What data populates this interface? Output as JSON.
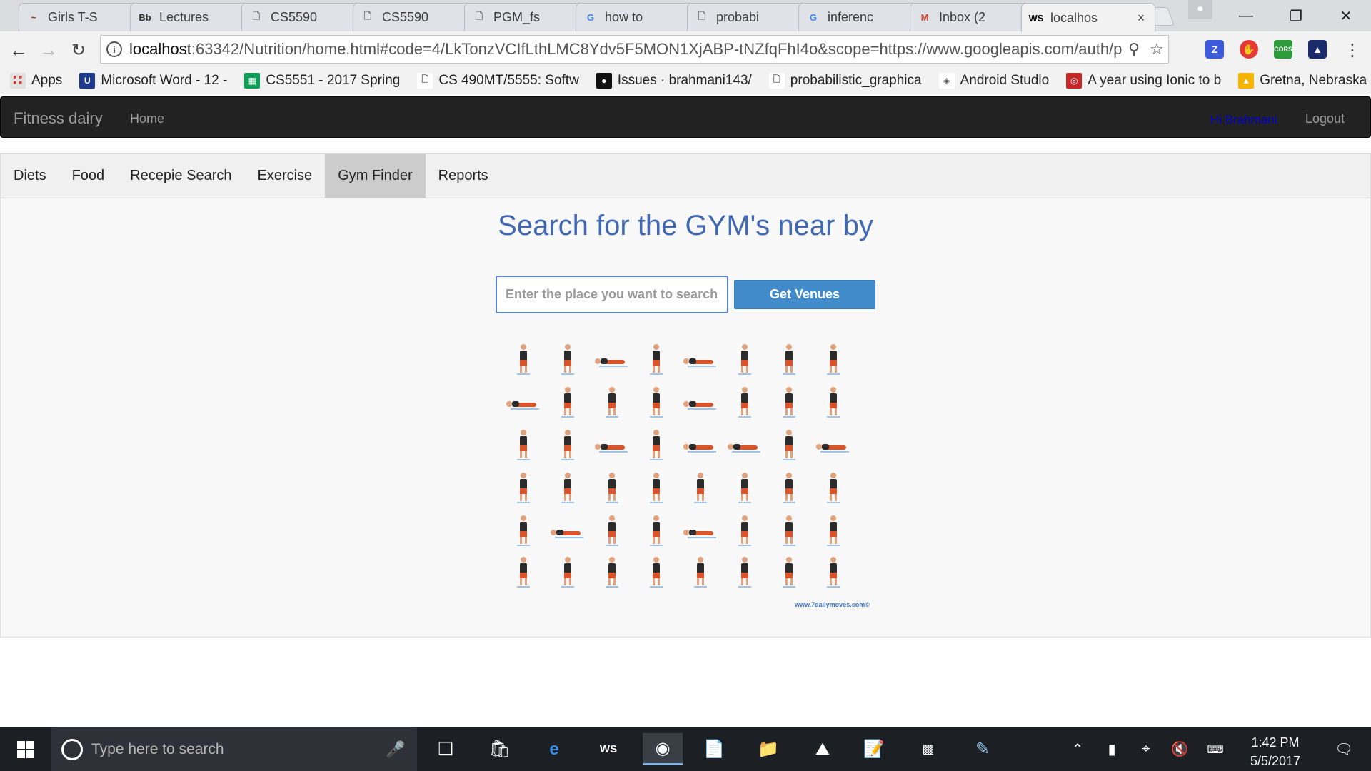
{
  "browser": {
    "tabs": [
      {
        "title": "Girls T-S",
        "favicon": "hollister-icon",
        "color": "#a03a2d"
      },
      {
        "title": "Lectures",
        "favicon": "blackboard-icon",
        "color": "#333333"
      },
      {
        "title": "CS5590",
        "favicon": "page-icon",
        "color": "#777777"
      },
      {
        "title": "CS5590",
        "favicon": "page-icon",
        "color": "#777777"
      },
      {
        "title": "PGM_fs",
        "favicon": "page-icon",
        "color": "#777777"
      },
      {
        "title": "how to",
        "favicon": "google-icon",
        "color": "#4285f4"
      },
      {
        "title": "probabi",
        "favicon": "page-icon",
        "color": "#777777"
      },
      {
        "title": "inferenc",
        "favicon": "google-icon",
        "color": "#4285f4"
      },
      {
        "title": "Inbox (2",
        "favicon": "gmail-icon",
        "color": "#d44638"
      },
      {
        "title": "localhos",
        "favicon": "webstorm-icon",
        "color": "#000000"
      }
    ],
    "url_host": "localhost",
    "url_rest": ":63342/Nutrition/home.html#code=4/LkTonzVCIfLthLMC8Ydv5F5MON1XjABP-tNZfqFhI4o&scope=https://www.googleapis.com/auth/plus.login",
    "bookmarks": [
      {
        "label": "Apps",
        "icon": "apps-grid-icon",
        "color": "#e0e0e0"
      },
      {
        "label": "Microsoft Word - 12 -",
        "icon": "umkc-icon",
        "color": "#1f3a8a"
      },
      {
        "label": "CS5551 - 2017 Spring",
        "icon": "sheets-icon",
        "color": "#0f9d58"
      },
      {
        "label": "CS 490MT/5555: Softw",
        "icon": "page-icon",
        "color": "#ffffff"
      },
      {
        "label": "Issues · brahmani143/",
        "icon": "github-icon",
        "color": "#111111"
      },
      {
        "label": "probabilistic_graphica",
        "icon": "page-icon",
        "color": "#ffffff"
      },
      {
        "label": "Android Studio",
        "icon": "android-studio-icon",
        "color": "#ffffff"
      },
      {
        "label": "A year using Ionic to b",
        "icon": "ionic-icon",
        "color": "#c62828"
      },
      {
        "label": "Gretna, Nebraska Cam",
        "icon": "campground-icon",
        "color": "#f5b400"
      }
    ]
  },
  "app": {
    "brand": "Fitness dairy",
    "home": "Home",
    "user_greeting": "Hi Brahmani",
    "logout": "Logout",
    "tabs": [
      "Diets",
      "Food",
      "Recepie Search",
      "Exercise",
      "Gym Finder",
      "Reports"
    ],
    "selected_tab": "Gym Finder",
    "heading": "Search for the GYM's near by",
    "search_placeholder": "Enter the place you want to search",
    "search_value": "",
    "button_label": "Get Venues",
    "image_watermark": "www.7dailymoves.com©",
    "accent_color": "#4169b3",
    "button_color": "#428bca"
  },
  "taskbar": {
    "search_placeholder": "Type here to search",
    "time": "1:42 PM",
    "date": "5/5/2017"
  }
}
